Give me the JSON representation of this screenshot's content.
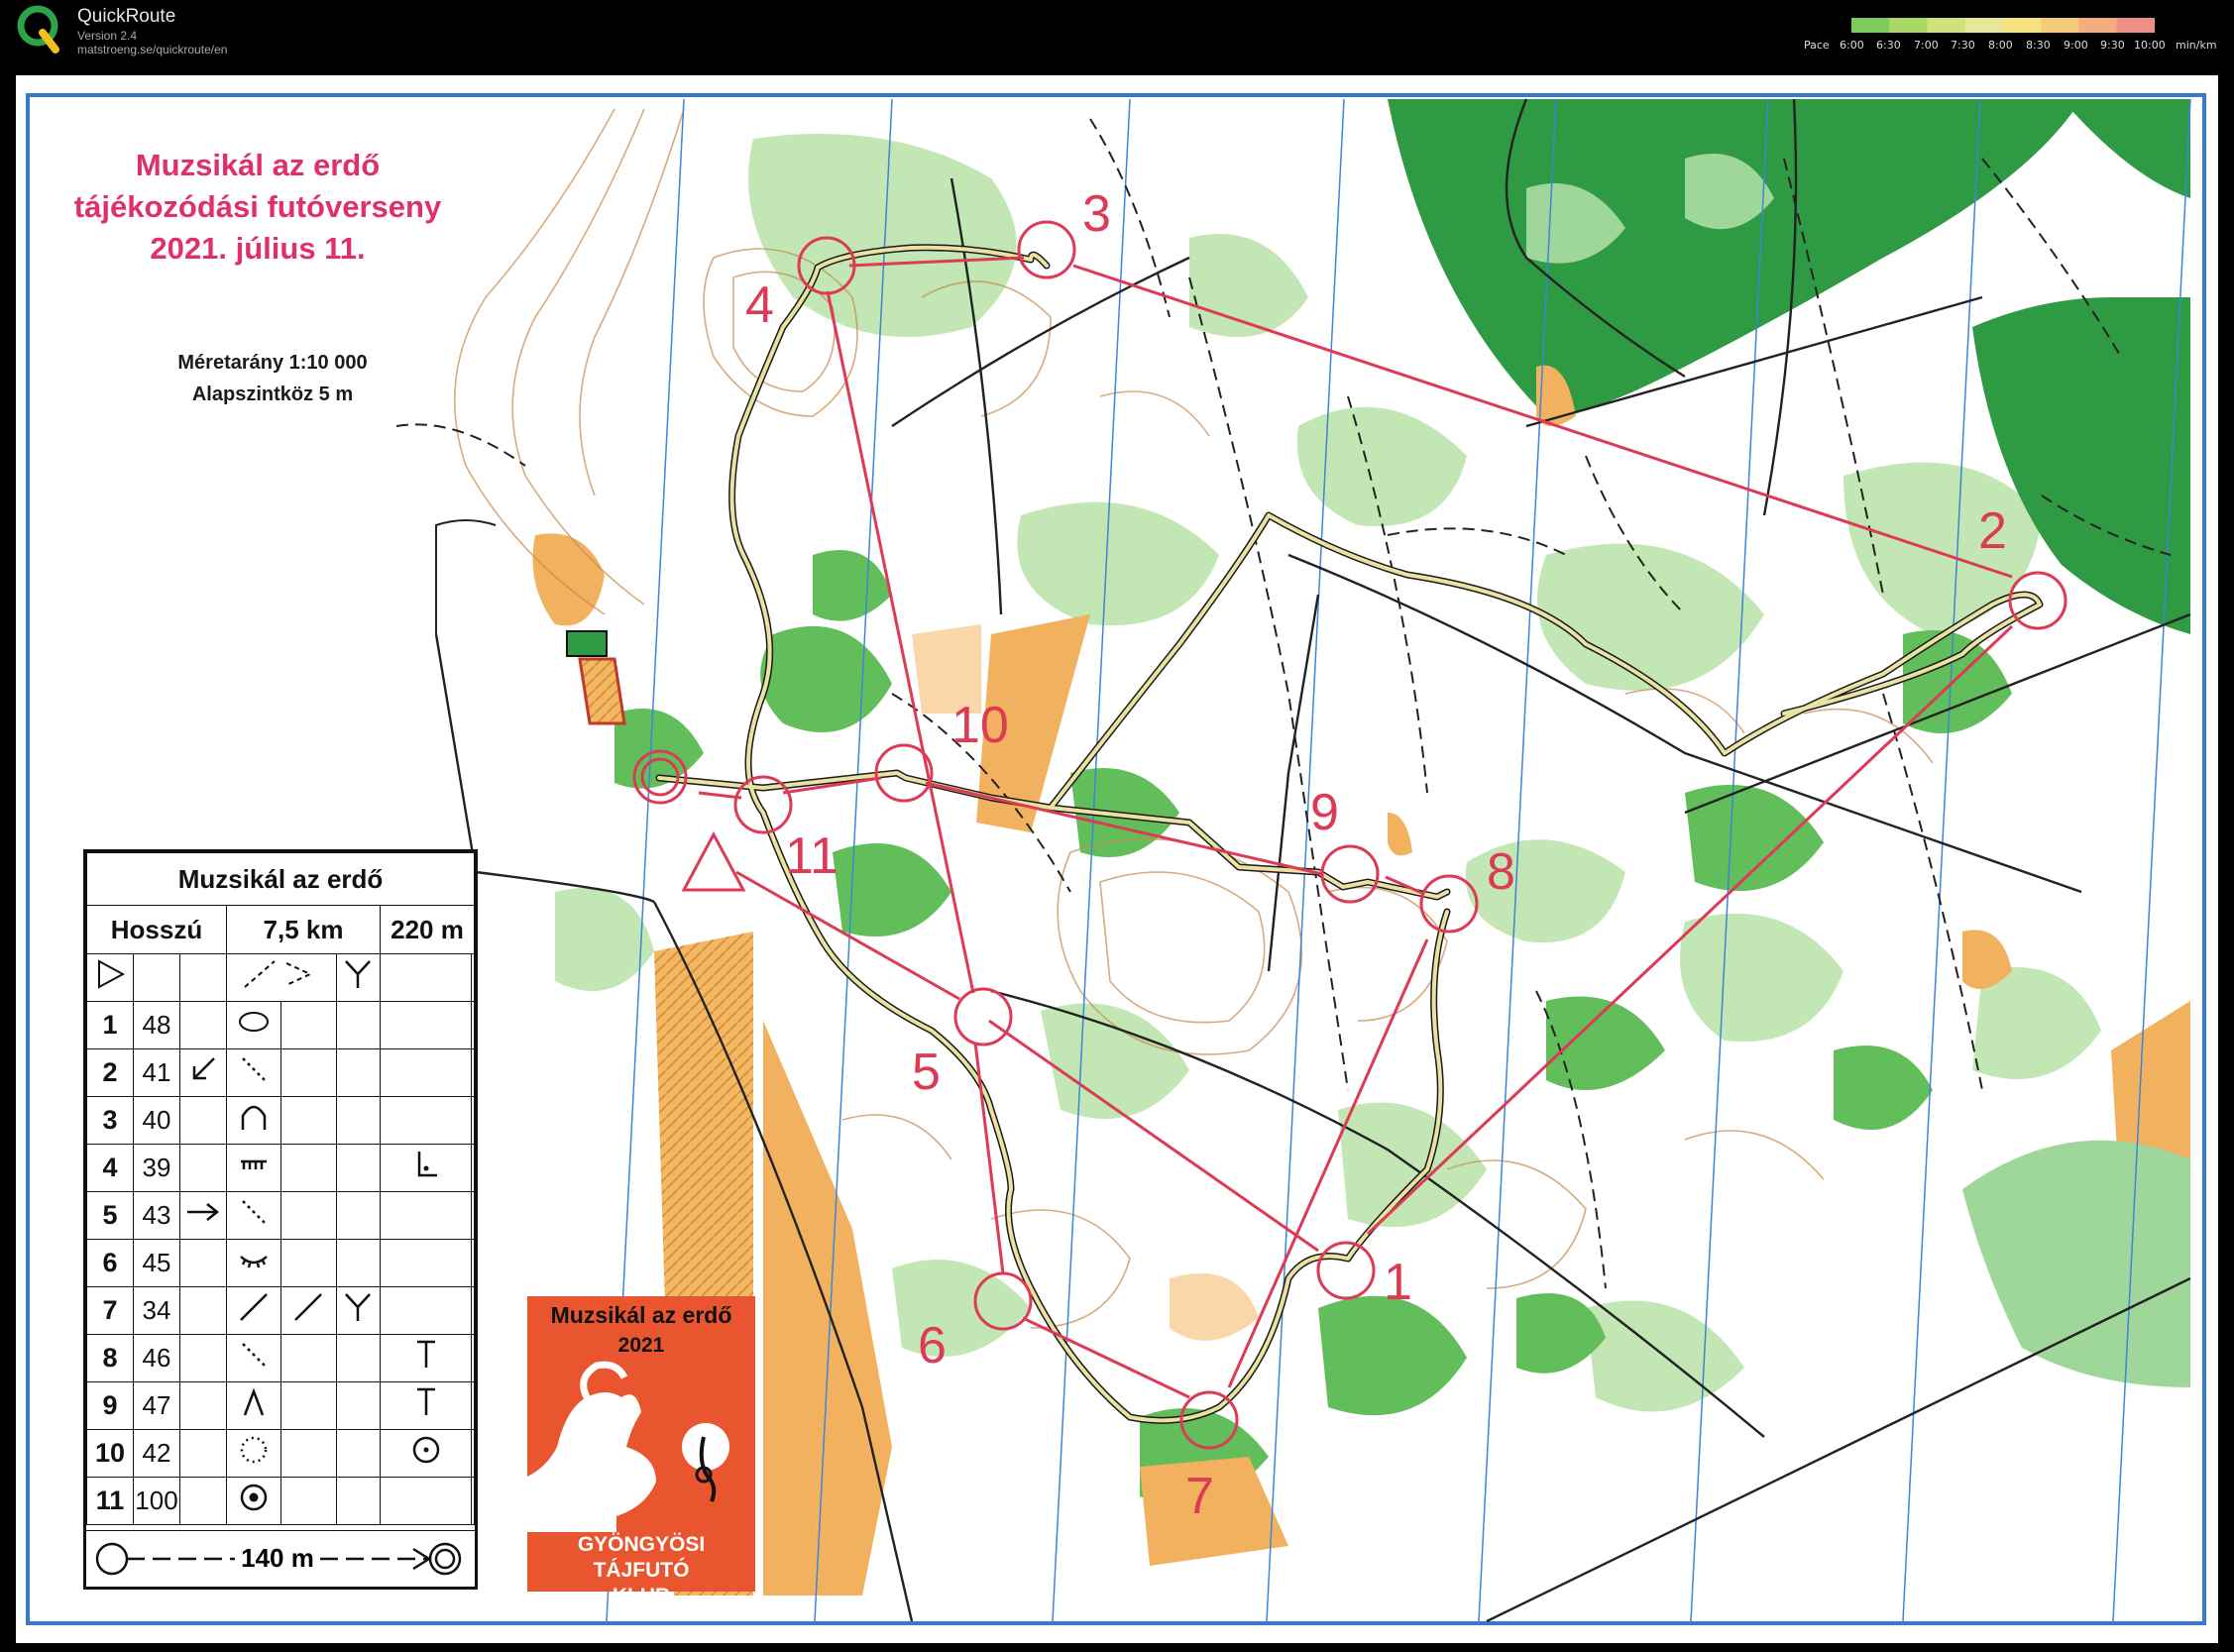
{
  "app": {
    "name": "QuickRoute",
    "version": "Version 2.4",
    "url": "matstroeng.se/quickroute/en",
    "pace_label": "Pace",
    "pace_ticks": [
      "6:00",
      "6:30",
      "7:00",
      "7:30",
      "8:00",
      "8:30",
      "9:00",
      "9:30",
      "10:00"
    ],
    "pace_unit": "min/km",
    "pace_colors": [
      "#7dcc5b",
      "#a9d864",
      "#cfe37a",
      "#e7e79a",
      "#f3e27e",
      "#f6cb78",
      "#f4ad7c",
      "#ef8e86"
    ]
  },
  "map": {
    "title_lines": [
      "Muzsikál az erdő",
      "tájékozódási futóverseny",
      "2021. július 11."
    ],
    "scale_lines": [
      "Méretarány 1:10 000",
      "Alapszintköz 5 m"
    ],
    "course_color": "#dc3a55",
    "control_labels": [
      "1",
      "2",
      "3",
      "4",
      "5",
      "6",
      "7",
      "8",
      "9",
      "10",
      "11"
    ]
  },
  "description": {
    "event": "Muzsikál az erdő",
    "course_label": "Hosszú",
    "length": "7,5 km",
    "climb": "220 m",
    "controls": [
      {
        "num": "1",
        "code": "48"
      },
      {
        "num": "2",
        "code": "41"
      },
      {
        "num": "3",
        "code": "40"
      },
      {
        "num": "4",
        "code": "39"
      },
      {
        "num": "5",
        "code": "43"
      },
      {
        "num": "6",
        "code": "45"
      },
      {
        "num": "7",
        "code": "34"
      },
      {
        "num": "8",
        "code": "46"
      },
      {
        "num": "9",
        "code": "47"
      },
      {
        "num": "10",
        "code": "42"
      },
      {
        "num": "11",
        "code": "100"
      }
    ],
    "finish_distance": "140 m"
  },
  "badge": {
    "title": "Muzsikál az erdő",
    "year": "2021",
    "club_lines": [
      "GYÖNGYÖSI TÁJFUTÓ",
      "KLUB"
    ]
  }
}
